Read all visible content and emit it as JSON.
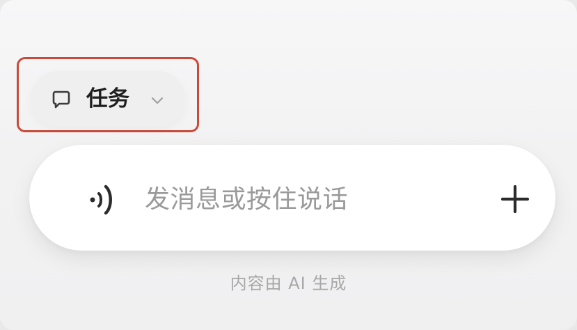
{
  "mode_selector": {
    "label": "任务",
    "icon": "chat-bubble-icon",
    "dropdown_icon": "chevron-down-icon"
  },
  "composer": {
    "voice_icon": "voice-icon",
    "placeholder": "发消息或按住说话",
    "add_icon": "plus-icon"
  },
  "footer": {
    "note": "内容由 AI 生成"
  },
  "colors": {
    "highlight": "#c94a3b",
    "text_primary": "#1f1f1f",
    "placeholder": "#9a9a9a",
    "footer_text": "#a7a7a7",
    "surface": "#ffffff",
    "background": "#f3f3f4"
  }
}
